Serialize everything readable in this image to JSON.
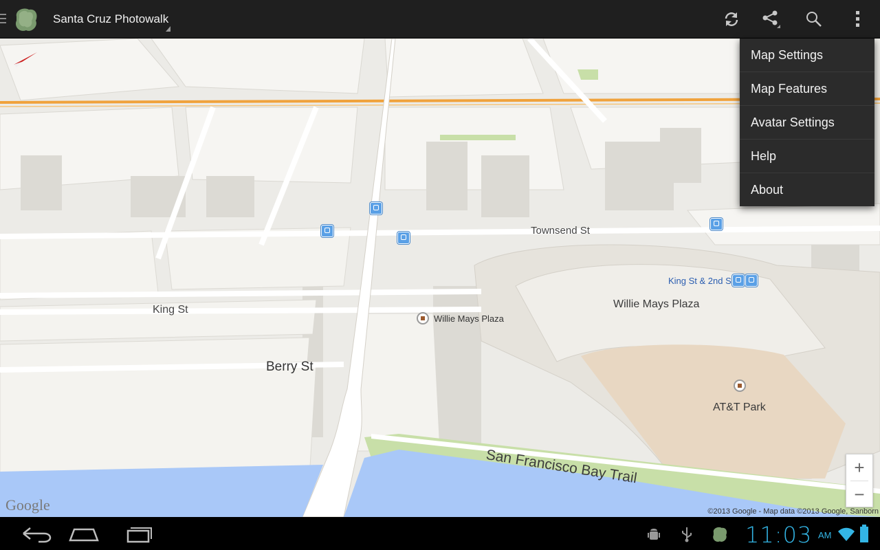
{
  "app": {
    "title": "Santa Cruz Photowalk",
    "logo_icon": "photowalk-logo-icon"
  },
  "actions": [
    {
      "name": "refresh-icon"
    },
    {
      "name": "share-icon"
    },
    {
      "name": "search-icon"
    },
    {
      "name": "overflow-menu-icon"
    }
  ],
  "menu": {
    "items": [
      "Map Settings",
      "Map Features",
      "Avatar Settings",
      "Help",
      "About"
    ]
  },
  "map": {
    "streets": {
      "townsend": "Townsend St",
      "king": "King St",
      "berry": "Berry St"
    },
    "places": {
      "willie_mays_plaza_pin": "Willie Mays Plaza",
      "willie_mays_plaza_area": "Willie Mays Plaza",
      "att_park": "AT&T Park",
      "king_2nd": "King St & 2nd St"
    },
    "trail": "San Francisco Bay Trail",
    "logo": "Google",
    "attribution": "©2013 Google - Map data ©2013 Google, Sanborn",
    "zoom_in": "+",
    "zoom_out": "−",
    "colors": {
      "land": "#ecebe7",
      "water": "#a9c8f8",
      "park_green": "#c8dfa8",
      "highway": "#f0a23c",
      "transit_blue": "#5aa0e6"
    }
  },
  "system": {
    "time": "11:03",
    "ampm": "AM",
    "nav": [
      "back-icon",
      "home-icon",
      "recent-apps-icon"
    ],
    "status_icons": [
      "android-debug-icon",
      "usb-icon",
      "app-notification-icon",
      "wifi-icon",
      "battery-icon"
    ]
  }
}
